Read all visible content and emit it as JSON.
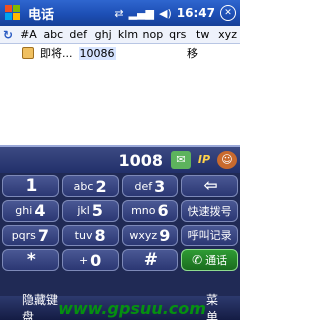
{
  "title_bar": {
    "app_title": "电话",
    "time": "16:47",
    "close_label": "✕"
  },
  "filter_tabs": [
    "#A",
    "abc",
    "def",
    "ghj",
    "klm",
    "nop",
    "qrs",
    "tw",
    "xyz"
  ],
  "contacts": [
    {
      "name": "即将...",
      "number": "10086",
      "label": "移"
    }
  ],
  "dialer": {
    "number": "1008",
    "ip_label": "IP"
  },
  "keys": [
    {
      "digit": "1",
      "letters": ""
    },
    {
      "digit": "2",
      "letters": "abc"
    },
    {
      "digit": "3",
      "letters": "def"
    },
    {
      "label": "⇦"
    },
    {
      "digit": "4",
      "letters": "ghi"
    },
    {
      "digit": "5",
      "letters": "jkl"
    },
    {
      "digit": "6",
      "letters": "mno"
    },
    {
      "label": "快速拨号"
    },
    {
      "digit": "7",
      "letters": "pqrs"
    },
    {
      "digit": "8",
      "letters": "tuv"
    },
    {
      "digit": "9",
      "letters": "wxyz"
    },
    {
      "label": "呼叫记录"
    },
    {
      "digit": "*",
      "letters": ""
    },
    {
      "digit": "0",
      "letters": "+"
    },
    {
      "digit": "#",
      "letters": ""
    },
    {
      "label": "通话"
    }
  ],
  "soft_keys": {
    "left": "隐藏键盘",
    "center": "www.gpsuu.com",
    "right": "菜单"
  },
  "colors": {
    "title_bar": "#1d4fb5",
    "keypad_bg": "#202a55",
    "call_key": "#2f9b34"
  }
}
